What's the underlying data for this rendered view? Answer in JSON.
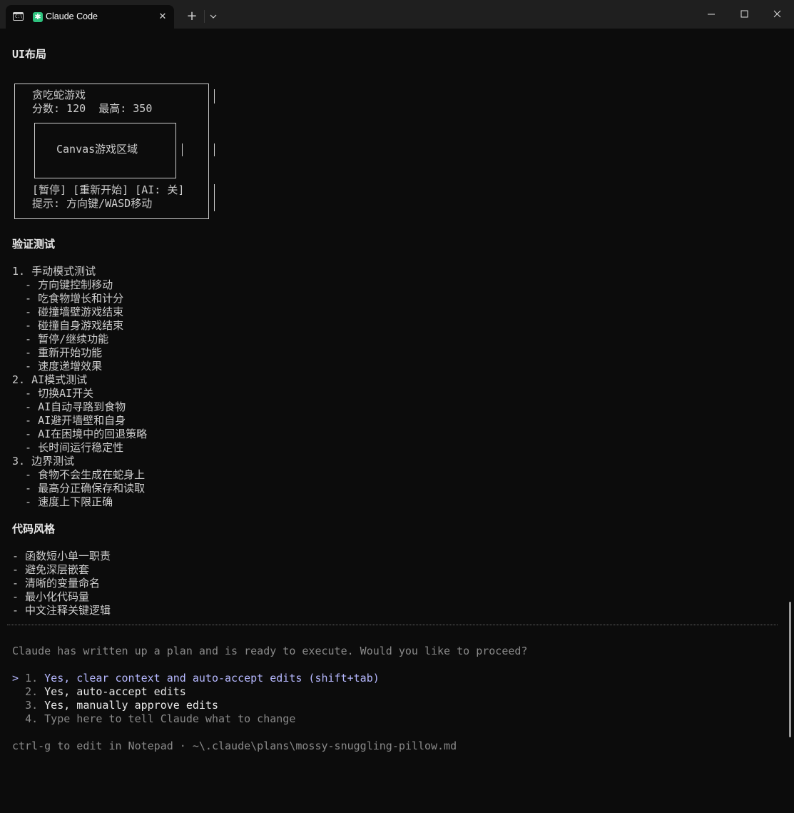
{
  "window": {
    "tab_title": "Claude Code",
    "tab_icon": "terminal-icon",
    "app_icon": "claude-asterisk-icon",
    "app_icon_glyph": "✱",
    "accent_color": "#2ec27e"
  },
  "doc": {
    "ui_layout_heading": "UI布局",
    "box": {
      "title": "贪吃蛇游戏",
      "score_line": "分数: 120  最高: 350",
      "canvas_label": "Canvas游戏区域",
      "buttons_line": "[暂停] [重新开始] [AI: 关]",
      "hint_line": "提示: 方向键/WASD移动"
    },
    "verify_heading": "验证测试",
    "tests": [
      "1. 手动模式测试",
      "  - 方向键控制移动",
      "  - 吃食物增长和计分",
      "  - 碰撞墙壁游戏结束",
      "  - 碰撞自身游戏结束",
      "  - 暂停/继续功能",
      "  - 重新开始功能",
      "  - 速度递增效果",
      "2. AI模式测试",
      "  - 切换AI开关",
      "  - AI自动寻路到食物",
      "  - AI避开墙壁和自身",
      "  - AI在困境中的回退策略",
      "  - 长时间运行稳定性",
      "3. 边界测试",
      "  - 食物不会生成在蛇身上",
      "  - 最高分正确保存和读取",
      "  - 速度上下限正确"
    ],
    "style_heading": "代码风格",
    "style_items": [
      "- 函数短小单一职责",
      "- 避免深层嵌套",
      "- 清晰的变量命名",
      "- 最小化代码量",
      "- 中文注释关键逻辑"
    ]
  },
  "prompt": {
    "question": "Claude has written up a plan and is ready to execute. Would you like to proceed?",
    "options": [
      {
        "marker": "> ",
        "num": "1. ",
        "label": "Yes, clear context and auto-accept edits (shift+tab)"
      },
      {
        "marker": "  ",
        "num": "2. ",
        "label": "Yes, auto-accept edits"
      },
      {
        "marker": "  ",
        "num": "3. ",
        "label": "Yes, manually approve edits"
      },
      {
        "marker": "  ",
        "num": "4. ",
        "label": "Type here to tell Claude what to change"
      }
    ],
    "footer": "ctrl-g to edit in Notepad · ~\\.claude\\plans\\mossy-snuggling-pillow.md"
  }
}
